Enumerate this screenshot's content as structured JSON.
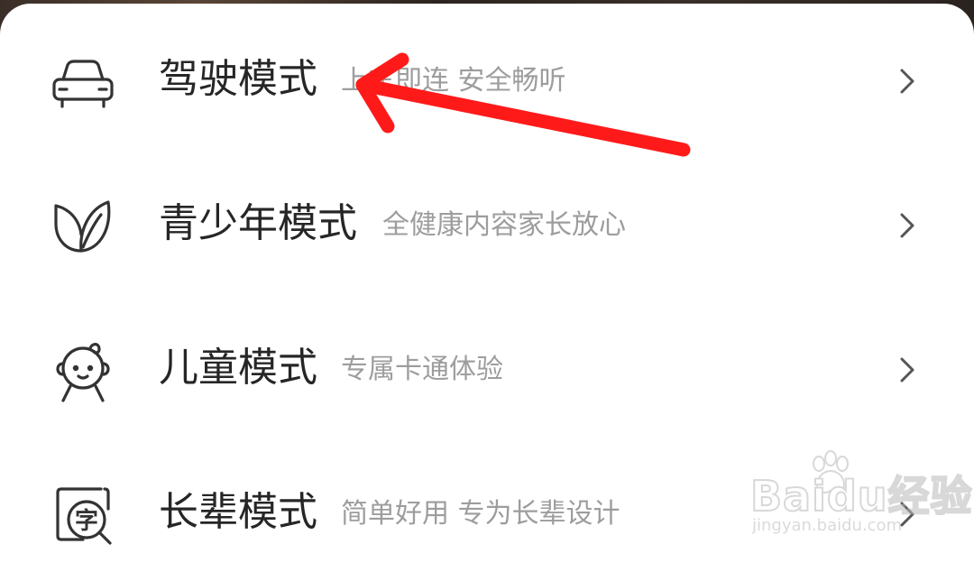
{
  "menu": {
    "items": [
      {
        "title": "驾驶模式",
        "subtitle": "上车即连 安全畅听",
        "icon": "car-icon"
      },
      {
        "title": "青少年模式",
        "subtitle": "全健康内容家长放心",
        "icon": "leaf-icon"
      },
      {
        "title": "儿童模式",
        "subtitle": "专属卡通体验",
        "icon": "child-face-icon"
      },
      {
        "title": "长辈模式",
        "subtitle": "简单好用 专为长辈设计",
        "icon": "text-size-icon"
      }
    ]
  },
  "watermark": {
    "brand": "Baidu经验",
    "url": "jingyan.baidu.com"
  },
  "colors": {
    "annotation_arrow": "#ff1a1a",
    "title_text": "#262626",
    "subtitle_text": "#9d9d9d",
    "icon_stroke": "#333333"
  }
}
